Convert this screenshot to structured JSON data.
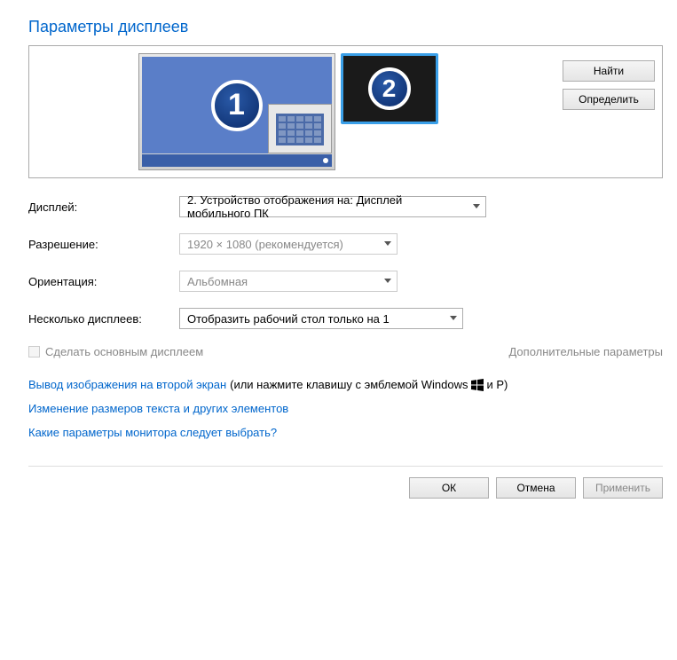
{
  "title": "Параметры дисплеев",
  "preview": {
    "monitor1_number": "1",
    "monitor2_number": "2",
    "find_button": "Найти",
    "identify_button": "Определить"
  },
  "settings": {
    "display_label": "Дисплей:",
    "display_value": "2. Устройство отображения на: Дисплей мобильного ПК",
    "resolution_label": "Разрешение:",
    "resolution_value": "1920 × 1080 (рекомендуется)",
    "orientation_label": "Ориентация:",
    "orientation_value": "Альбомная",
    "multidisplay_label": "Несколько дисплеев:",
    "multidisplay_value": "Отобразить рабочий стол только на 1"
  },
  "primary": {
    "checkbox_label": "Сделать основным дисплеем",
    "advanced_link": "Дополнительные параметры"
  },
  "links": {
    "project_link": "Вывод изображения на второй экран",
    "project_suffix_a": "(или нажмите клавишу с эмблемой Windows",
    "project_suffix_b": "и P)",
    "textsize_link": "Изменение размеров текста и других элементов",
    "which_link": "Какие параметры монитора следует выбрать?"
  },
  "dialog": {
    "ok": "ОК",
    "cancel": "Отмена",
    "apply": "Применить"
  }
}
